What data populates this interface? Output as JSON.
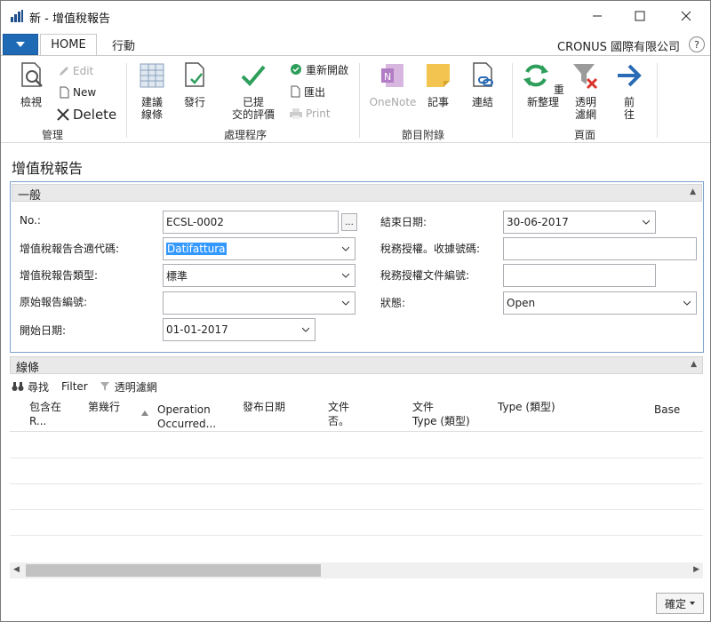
{
  "window": {
    "title": "新 - 增值稅報告",
    "icon": "chart-app-icon",
    "minimize_icon": "minimize-icon",
    "maximize_icon": "maximize-icon",
    "close_icon": "close-icon"
  },
  "tabs": {
    "home": "HOME",
    "actions": "行動"
  },
  "company": "CRONUS 國際有限公司",
  "help_label": "?",
  "ribbon": {
    "manage": {
      "label": "管理",
      "view": "檢視",
      "edit": "Edit",
      "new": "New",
      "delete": "Delete"
    },
    "process": {
      "label": "處理程序",
      "suggest_lines_1": "建議",
      "suggest_lines_2": "線條",
      "release": "發行",
      "submitted_1": "已提",
      "submitted_2": "交的評價",
      "reopen": "重新開啟",
      "export": "匯出",
      "print": "Print"
    },
    "attach": {
      "label": "節目附錄",
      "onenote": "OneNote",
      "notes": "記事",
      "links": "連結"
    },
    "page": {
      "label": "頁面",
      "refresh": "重新整理",
      "clear_filter_1": "透明",
      "clear_filter_2": "濾網",
      "next_1": "前",
      "next_2": "往"
    }
  },
  "page_title": "增值稅報告",
  "general": {
    "header": "一般",
    "no_label": "No.:",
    "no_value": "ECSL-0002",
    "config_label": "增值稅報告合適代碼:",
    "config_value": "Datifattura",
    "type_label": "增值稅報告類型:",
    "type_value": "標準",
    "orig_label": "原始報告編號:",
    "orig_value": "",
    "start_label": "開始日期:",
    "start_value": "01-01-2017",
    "end_label": "結束日期:",
    "end_value": "30-06-2017",
    "tax_auth_receipt_label": "稅務授權。收據號碼:",
    "tax_auth_receipt_value": "",
    "tax_auth_doc_label": "稅務授權文件編號:",
    "tax_auth_doc_value": "",
    "status_label": "狀態:",
    "status_value": "Open",
    "assist_label": "..."
  },
  "lines": {
    "header": "線條",
    "find": "尋找",
    "filter": "Filter",
    "clear_filter": "透明濾網",
    "columns": [
      {
        "l1": "包含在",
        "l2": "R..."
      },
      {
        "l1": "第幾行",
        "l2": ""
      },
      {
        "l1": "Operation",
        "l2": "Occurred..."
      },
      {
        "l1": "發布日期",
        "l2": ""
      },
      {
        "l1": "文件",
        "l2": "否。"
      },
      {
        "l1": "文件",
        "l2": "Type (類型)"
      },
      {
        "l1": "Type (類型)",
        "l2": ""
      },
      {
        "l1": "Base",
        "l2": ""
      }
    ]
  },
  "ok_button": "確定"
}
